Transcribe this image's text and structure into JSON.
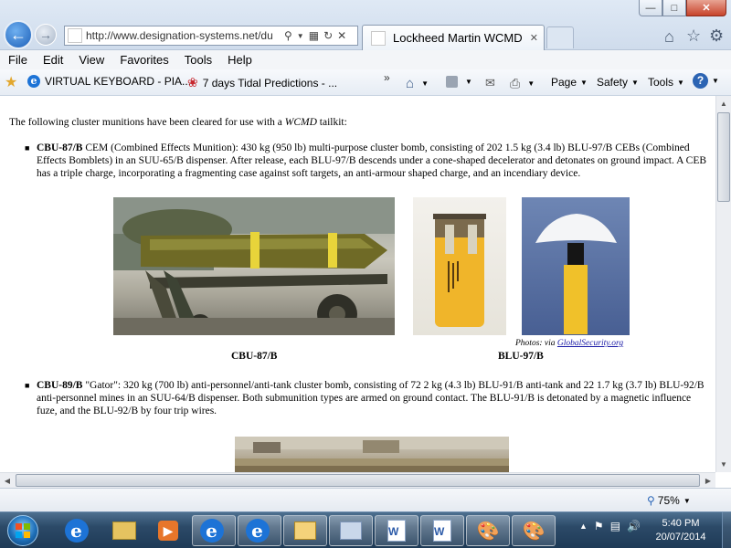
{
  "window": {
    "minimize_icon": "minimize-icon",
    "maximize_icon": "maximize-icon",
    "close_icon": "close-icon"
  },
  "nav": {
    "url": "http://www.designation-systems.net/du",
    "tab_title": "Lockheed Martin WCMD"
  },
  "menu": [
    "File",
    "Edit",
    "View",
    "Favorites",
    "Tools",
    "Help"
  ],
  "favorites": {
    "item1": "VIRTUAL KEYBOARD - PIA...",
    "item2": "7 days Tidal Predictions - ...",
    "more": "»"
  },
  "commands": {
    "page": "Page",
    "safety": "Safety",
    "tools": "Tools"
  },
  "content": {
    "intro_prefix": "The following cluster munitions have been cleared for use with a ",
    "intro_em": "WCMD",
    "intro_suffix": " tailkit:",
    "item1_title": "CBU-87/B",
    "item1_text": " CEM (Combined Effects Munition): 430 kg (950 lb) multi-purpose cluster bomb, consisting of 202 1.5 kg (3.4 lb) BLU-97/B CEBs (Combined Effects Bomblets) in an SUU-65/B dispenser. After release, each BLU-97/B descends under a cone-shaped decelerator and detonates on ground impact. A CEB has a triple charge, incorporating a fragmenting case against soft targets, an anti-armour shaped charge, and an incendiary device.",
    "credit_prefix": "Photos: via ",
    "credit_link": "GlobalSecurity.org",
    "caption1": "CBU-87/B",
    "caption2": "BLU-97/B",
    "item2_title": "CBU-89/B",
    "item2_text": " \"Gator\": 320 kg (700 lb) anti-personnel/anti-tank cluster bomb, consisting of 72 2 kg (4.3 lb) BLU-91/B anti-tank and 22 1.7 kg (3.7 lb) BLU-92/B anti-personnel mines in an SUU-64/B dispenser. Both submunition types are armed on ground contact. The BLU-91/B is detonated by a magnetic influence fuze, and the BLU-92/B by four trip wires."
  },
  "status": {
    "zoom": "75%"
  },
  "taskbar": {
    "time": "5:40 PM",
    "date": "20/07/2014"
  }
}
